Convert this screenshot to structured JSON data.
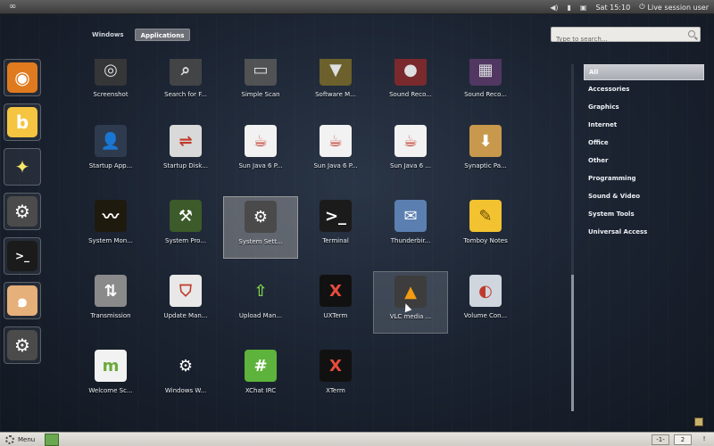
{
  "top_panel": {
    "clock": "Sat 15:10",
    "user": "Live session user"
  },
  "view_tabs": [
    {
      "label": "Windows",
      "active": false
    },
    {
      "label": "Applications",
      "active": true
    }
  ],
  "search": {
    "placeholder": "Type to search..."
  },
  "favorites": [
    {
      "name": "eye-app-icon",
      "bg": "#e07a1f",
      "glyph": "◉"
    },
    {
      "name": "b-app-icon",
      "bg": "#f5c542",
      "glyph": "b"
    },
    {
      "name": "star-app-icon",
      "bg": "transparent",
      "glyph": "✦"
    },
    {
      "name": "settings-app-icon",
      "bg": "#4b4b4b",
      "glyph": "⚙"
    },
    {
      "name": "terminal-app-icon",
      "bg": "#1b1b1b",
      "glyph": ">_"
    },
    {
      "name": "shell-app-icon",
      "bg": "#e6b07a",
      "glyph": "๑"
    },
    {
      "name": "control-center-app-icon",
      "bg": "#4b4b4b",
      "glyph": "⚙"
    }
  ],
  "apps": [
    {
      "label": "Screenshot",
      "icon": "camera-icon",
      "bg": "#3a3a3a",
      "glyph": "◎",
      "partial": true
    },
    {
      "label": "Search for F...",
      "icon": "search-files-icon",
      "bg": "#4a4a4a",
      "glyph": "⌕",
      "partial": true
    },
    {
      "label": "Simple Scan",
      "icon": "scanner-icon",
      "bg": "#5a5a5a",
      "glyph": "▭",
      "partial": true
    },
    {
      "label": "Software M...",
      "icon": "software-manager-icon",
      "bg": "#7a6a2a",
      "glyph": "▼",
      "partial": true
    },
    {
      "label": "Sound Reco...",
      "icon": "microphone-icon",
      "bg": "#8a2a2a",
      "glyph": "●",
      "partial": true
    },
    {
      "label": "Sound Reco...",
      "icon": "equalizer-icon",
      "bg": "#5a3a6a",
      "glyph": "▦",
      "partial": true
    },
    {
      "label": "Startup App...",
      "icon": "startup-apps-icon",
      "bg": "#2e3b4e",
      "glyph": "👤"
    },
    {
      "label": "Startup Disk...",
      "icon": "usb-drive-icon",
      "bg": "#d9d9d9",
      "glyph": "⇌"
    },
    {
      "label": "Sun Java 6 P...",
      "icon": "java-icon",
      "bg": "#f2f2f2",
      "glyph": "☕"
    },
    {
      "label": "Sun Java 6 P...",
      "icon": "java-icon",
      "bg": "#f2f2f2",
      "glyph": "☕"
    },
    {
      "label": "Sun Java 6 ...",
      "icon": "java-icon",
      "bg": "#f2f2f2",
      "glyph": "☕"
    },
    {
      "label": "Synaptic Pa...",
      "icon": "package-icon",
      "bg": "#c8994c",
      "glyph": "⬇"
    },
    {
      "label": "System Mon...",
      "icon": "system-monitor-icon",
      "bg": "#1f1a0e",
      "glyph": "〰"
    },
    {
      "label": "System Pro...",
      "icon": "system-profiler-icon",
      "bg": "#3c5a2a",
      "glyph": "⚒"
    },
    {
      "label": "System Sett...",
      "icon": "system-settings-icon",
      "bg": "#4a4a4a",
      "glyph": "⚙",
      "selected": true
    },
    {
      "label": "Terminal",
      "icon": "terminal-icon",
      "bg": "#1b1b1b",
      "glyph": ">_"
    },
    {
      "label": "Thunderbir...",
      "icon": "thunderbird-icon",
      "bg": "#5b7fb0",
      "glyph": "✉"
    },
    {
      "label": "Tomboy Notes",
      "icon": "notes-icon",
      "bg": "#f2c230",
      "glyph": "✎"
    },
    {
      "label": "Transmission",
      "icon": "transmission-icon",
      "bg": "#8a8a8a",
      "glyph": "⇅"
    },
    {
      "label": "Update Man...",
      "icon": "shield-icon",
      "bg": "#e8e8e8",
      "glyph": "⛉"
    },
    {
      "label": "Upload Man...",
      "icon": "upload-icon",
      "bg": "transparent",
      "glyph": "⇧"
    },
    {
      "label": "UXTerm",
      "icon": "xterm-icon",
      "bg": "#111111",
      "glyph": "X"
    },
    {
      "label": "VLC media ...",
      "icon": "vlc-icon",
      "bg": "#3d3d3d",
      "glyph": "▲",
      "hover": true
    },
    {
      "label": "Volume Con...",
      "icon": "volume-control-icon",
      "bg": "#cfd6dd",
      "glyph": "◐"
    },
    {
      "label": "Welcome Sc...",
      "icon": "mint-welcome-icon",
      "bg": "#f2f2f2",
      "glyph": "m"
    },
    {
      "label": "Windows W...",
      "icon": "windows-wireless-icon",
      "bg": "transparent",
      "glyph": "⚙"
    },
    {
      "label": "XChat IRC",
      "icon": "xchat-icon",
      "bg": "#5db33b",
      "glyph": "#"
    },
    {
      "label": "XTerm",
      "icon": "xterm-icon",
      "bg": "#111111",
      "glyph": "X"
    }
  ],
  "categories": [
    {
      "label": "All",
      "active": true
    },
    {
      "label": "Accessories"
    },
    {
      "label": "Graphics"
    },
    {
      "label": "Internet"
    },
    {
      "label": "Office"
    },
    {
      "label": "Other"
    },
    {
      "label": "Programming"
    },
    {
      "label": "Sound & Video"
    },
    {
      "label": "System Tools"
    },
    {
      "label": "Universal Access"
    }
  ],
  "bottom_panel": {
    "menu_label": "Menu",
    "workspaces": [
      "-1-",
      "2",
      "!"
    ]
  }
}
